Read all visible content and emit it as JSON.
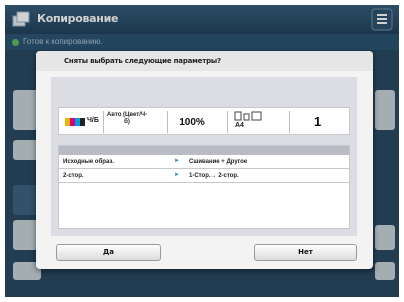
{
  "app": {
    "title": "Копирование",
    "status_text": "Готов к копированию."
  },
  "dialog": {
    "title": "Сняты выбрать следующие параметры?",
    "summary": {
      "color_mode": "Ч/Б",
      "paper_select": "Авто (Цвет/Ч-б)",
      "zoom": "100%",
      "paper_size": "A4",
      "copies": "1"
    },
    "settings": [
      {
        "name": "Исходные образ.",
        "value": "Сшивание + Другое"
      },
      {
        "name": "2-стор.",
        "value": "1-Стор.→ 2-стор."
      }
    ],
    "yes_label": "Да",
    "no_label": "Нет"
  },
  "colors": {
    "title_bar": "#21435d",
    "dialog_bg": "#f3f3f3",
    "arrow": "#3a89c9"
  },
  "icons": [
    "copy-app-icon",
    "menu-icon",
    "color-mode-icon",
    "paper-size-icon",
    "arrow-right-icon"
  ]
}
